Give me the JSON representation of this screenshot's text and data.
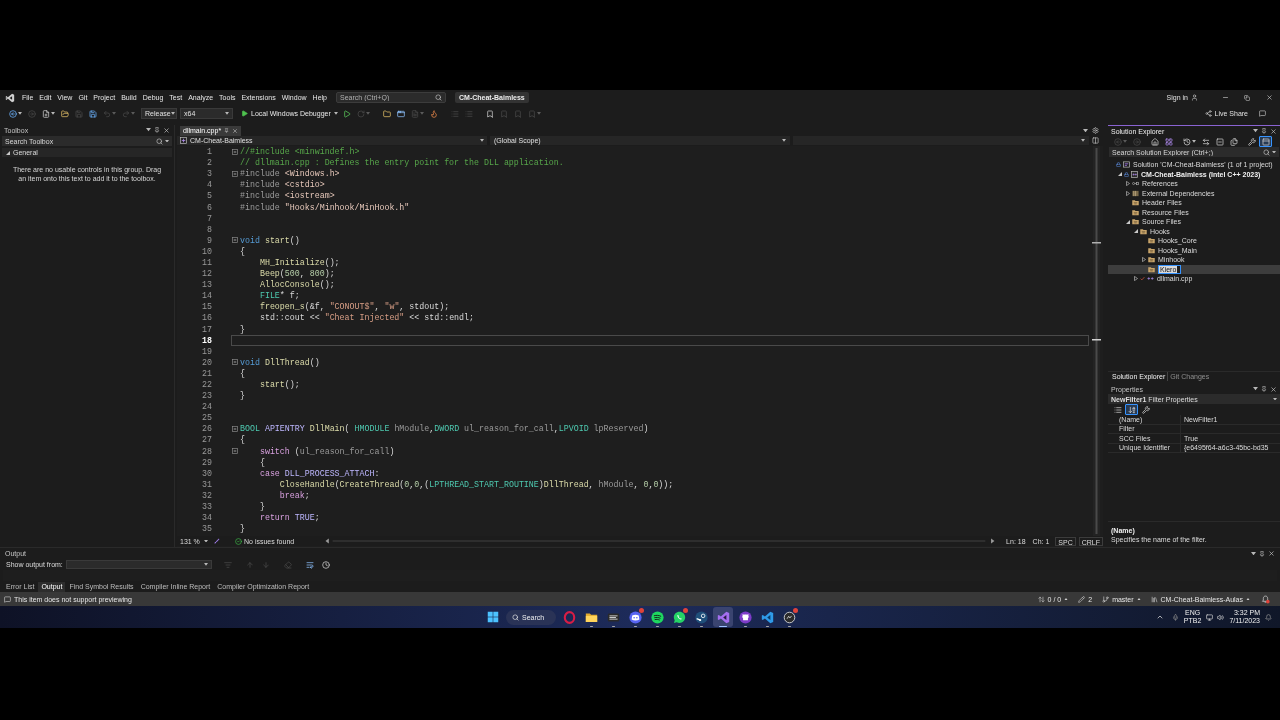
{
  "menu_bar": {
    "menus": [
      "File",
      "Edit",
      "View",
      "Git",
      "Project",
      "Build",
      "Debug",
      "Test",
      "Analyze",
      "Tools",
      "Extensions",
      "Window",
      "Help"
    ],
    "search": {
      "placeholder": "Search (Ctrl+Q)"
    },
    "solution": "CM-Cheat-Baimless",
    "sign_in": "Sign in"
  },
  "toolbar": {
    "left_buttons": [
      {
        "kind": "back",
        "disabled": false
      },
      {
        "kind": "forward",
        "disabled": true
      },
      {
        "kind": "new",
        "disabled": false
      },
      {
        "kind": "open",
        "disabled": false
      },
      {
        "kind": "save",
        "disabled": true
      },
      {
        "kind": "save_all",
        "disabled": false
      },
      {
        "kind": "undo",
        "disabled": true
      },
      {
        "kind": "redo",
        "disabled": true
      }
    ],
    "configuration": "Release",
    "platform": "x64",
    "debugger": "Local Windows Debugger",
    "right_buttons": [
      {
        "kind": "start",
        "disabled": false
      },
      {
        "kind": "restart",
        "disabled": true
      },
      {
        "kind": "browse",
        "disabled": false
      },
      {
        "kind": "window",
        "disabled": false
      },
      {
        "kind": "document",
        "disabled": true
      },
      {
        "kind": "hot_reload",
        "disabled": false
      },
      {
        "kind": "indent",
        "disabled": true
      },
      {
        "kind": "outdent",
        "disabled": true
      },
      {
        "kind": "bookmark",
        "disabled": false
      },
      {
        "kind": "previous_bookmark",
        "disabled": true
      },
      {
        "kind": "next_bookmark",
        "disabled": true
      },
      {
        "kind": "clear_bookmarks",
        "disabled": true
      }
    ],
    "live_share": "Live Share"
  },
  "toolbox": {
    "title": "Toolbox",
    "search": {
      "placeholder": "Search Toolbox"
    },
    "groups": [
      {
        "label": "General",
        "expanded": true
      }
    ],
    "message": "There are no usable controls in this group. Drag an item onto this text to add it to the toolbox."
  },
  "editor": {
    "tabs": [
      {
        "label": "dllmain.cpp*",
        "selected": true
      }
    ],
    "navigation": {
      "project": "CM-Cheat-Baimless",
      "scope": "(Global Scope)"
    },
    "lines": [
      {
        "number": "1",
        "fold": true,
        "current": false,
        "tokens": [
          {
            "text": "//#include <minwindef.h>",
            "kind": "comment"
          }
        ]
      },
      {
        "number": "2",
        "fold": false,
        "current": false,
        "tokens": [
          {
            "text": "// dllmain.cpp : Defines the entry point for the DLL application.",
            "kind": "comment"
          }
        ]
      },
      {
        "number": "3",
        "fold": true,
        "current": false,
        "tokens": [
          {
            "text": "#include",
            "kind": "directive"
          },
          {
            "text": " <Windows.h>",
            "kind": "header"
          }
        ]
      },
      {
        "number": "4",
        "fold": false,
        "current": false,
        "tokens": [
          {
            "text": "#include",
            "kind": "directive"
          },
          {
            "text": " <cstdio>",
            "kind": "header"
          }
        ]
      },
      {
        "number": "5",
        "fold": false,
        "current": false,
        "tokens": [
          {
            "text": "#include",
            "kind": "directive"
          },
          {
            "text": " <iostream>",
            "kind": "header"
          }
        ]
      },
      {
        "number": "6",
        "fold": false,
        "current": false,
        "tokens": [
          {
            "text": "#include",
            "kind": "directive"
          },
          {
            "text": " \"Hooks/Minhook/MinHook.h\"",
            "kind": "header"
          }
        ]
      },
      {
        "number": "7",
        "fold": false,
        "current": false
      },
      {
        "number": "8",
        "fold": false,
        "current": false
      },
      {
        "number": "9",
        "fold": true,
        "current": false,
        "tokens": [
          {
            "text": "void",
            "kind": "keyword"
          },
          {
            "text": " start",
            "kind": "function"
          },
          {
            "text": "()",
            "kind": "plain"
          }
        ]
      },
      {
        "number": "10",
        "fold": false,
        "current": false,
        "tokens": [
          {
            "text": "{",
            "kind": "plain"
          }
        ]
      },
      {
        "number": "11",
        "fold": false,
        "current": false,
        "tokens": [
          {
            "text": "    MH_Initialize",
            "kind": "function"
          },
          {
            "text": "();",
            "kind": "plain"
          }
        ]
      },
      {
        "number": "12",
        "fold": false,
        "current": false,
        "tokens": [
          {
            "text": "    Beep",
            "kind": "function"
          },
          {
            "text": "(",
            "kind": "plain"
          },
          {
            "text": "500",
            "kind": "number"
          },
          {
            "text": ", ",
            "kind": "plain"
          },
          {
            "text": "800",
            "kind": "number"
          },
          {
            "text": ");",
            "kind": "plain"
          }
        ]
      },
      {
        "number": "13",
        "fold": false,
        "current": false,
        "tokens": [
          {
            "text": "    AllocConsole",
            "kind": "function"
          },
          {
            "text": "();",
            "kind": "plain"
          }
        ]
      },
      {
        "number": "14",
        "fold": false,
        "current": false,
        "tokens": [
          {
            "text": "    FILE",
            "kind": "type"
          },
          {
            "text": "* f;",
            "kind": "plain"
          }
        ]
      },
      {
        "number": "15",
        "fold": false,
        "current": false,
        "tokens": [
          {
            "text": "    freopen_s",
            "kind": "function"
          },
          {
            "text": "(&f, ",
            "kind": "plain"
          },
          {
            "text": "\"CONOUT$\"",
            "kind": "string"
          },
          {
            "text": ", ",
            "kind": "plain"
          },
          {
            "text": "\"w\"",
            "kind": "string"
          },
          {
            "text": ", stdout);",
            "kind": "plain"
          }
        ]
      },
      {
        "number": "16",
        "fold": false,
        "current": false,
        "tokens": [
          {
            "text": "    std::cout << ",
            "kind": "plain"
          },
          {
            "text": "\"Cheat Injected\"",
            "kind": "string"
          },
          {
            "text": " << std::endl;",
            "kind": "plain"
          }
        ]
      },
      {
        "number": "17",
        "fold": false,
        "current": false,
        "tokens": [
          {
            "text": "}",
            "kind": "plain"
          }
        ]
      },
      {
        "number": "18",
        "fold": false,
        "current": true
      },
      {
        "number": "19",
        "fold": false,
        "current": false
      },
      {
        "number": "20",
        "fold": true,
        "current": false,
        "tokens": [
          {
            "text": "void",
            "kind": "keyword"
          },
          {
            "text": " DllThread",
            "kind": "function"
          },
          {
            "text": "()",
            "kind": "plain"
          }
        ]
      },
      {
        "number": "21",
        "fold": false,
        "current": false,
        "tokens": [
          {
            "text": "{",
            "kind": "plain"
          }
        ]
      },
      {
        "number": "22",
        "fold": false,
        "current": false,
        "tokens": [
          {
            "text": "    start",
            "kind": "function"
          },
          {
            "text": "();",
            "kind": "plain"
          }
        ]
      },
      {
        "number": "23",
        "fold": false,
        "current": false,
        "tokens": [
          {
            "text": "}",
            "kind": "plain"
          }
        ]
      },
      {
        "number": "24",
        "fold": false,
        "current": false
      },
      {
        "number": "25",
        "fold": false,
        "current": false
      },
      {
        "number": "26",
        "fold": true,
        "current": false,
        "tokens": [
          {
            "text": "BOOL",
            "kind": "type"
          },
          {
            "text": " APIENTRY",
            "kind": "macro"
          },
          {
            "text": " DllMain",
            "kind": "function"
          },
          {
            "text": "( ",
            "kind": "plain"
          },
          {
            "text": "HMODULE",
            "kind": "type"
          },
          {
            "text": " hModule",
            "kind": "param"
          },
          {
            "text": ",",
            "kind": "plain"
          },
          {
            "text": "DWORD",
            "kind": "type"
          },
          {
            "text": " ul_reason_for_call",
            "kind": "param"
          },
          {
            "text": ",",
            "kind": "plain"
          },
          {
            "text": "LPVOID",
            "kind": "type"
          },
          {
            "text": " lpReserved",
            "kind": "param"
          },
          {
            "text": ")",
            "kind": "plain"
          }
        ]
      },
      {
        "number": "27",
        "fold": false,
        "current": false,
        "tokens": [
          {
            "text": "{",
            "kind": "plain"
          }
        ]
      },
      {
        "number": "28",
        "fold": true,
        "current": false,
        "tokens": [
          {
            "text": "    switch",
            "kind": "control"
          },
          {
            "text": " (",
            "kind": "plain"
          },
          {
            "text": "ul_reason_for_call",
            "kind": "param"
          },
          {
            "text": ")",
            "kind": "plain"
          }
        ]
      },
      {
        "number": "29",
        "fold": false,
        "current": false,
        "tokens": [
          {
            "text": "    {",
            "kind": "plain"
          }
        ]
      },
      {
        "number": "30",
        "fold": false,
        "current": false,
        "tokens": [
          {
            "text": "    case",
            "kind": "control"
          },
          {
            "text": " DLL_PROCESS_ATTACH",
            "kind": "macro"
          },
          {
            "text": ":",
            "kind": "plain"
          }
        ]
      },
      {
        "number": "31",
        "fold": false,
        "current": false,
        "tokens": [
          {
            "text": "        CloseHandle",
            "kind": "function"
          },
          {
            "text": "(",
            "kind": "plain"
          },
          {
            "text": "CreateThread",
            "kind": "function"
          },
          {
            "text": "(",
            "kind": "plain"
          },
          {
            "text": "0",
            "kind": "number"
          },
          {
            "text": ",",
            "kind": "plain"
          },
          {
            "text": "0",
            "kind": "number"
          },
          {
            "text": ",(",
            "kind": "plain"
          },
          {
            "text": "LPTHREAD_START_ROUTINE",
            "kind": "type"
          },
          {
            "text": ")",
            "kind": "plain"
          },
          {
            "text": "DllThread",
            "kind": "function"
          },
          {
            "text": ", ",
            "kind": "plain"
          },
          {
            "text": "hModule",
            "kind": "param"
          },
          {
            "text": ", ",
            "kind": "plain"
          },
          {
            "text": "0",
            "kind": "number"
          },
          {
            "text": ",",
            "kind": "plain"
          },
          {
            "text": "0",
            "kind": "number"
          },
          {
            "text": "));",
            "kind": "plain"
          }
        ]
      },
      {
        "number": "32",
        "fold": false,
        "current": false,
        "tokens": [
          {
            "text": "        break",
            "kind": "control"
          },
          {
            "text": ";",
            "kind": "plain"
          }
        ]
      },
      {
        "number": "33",
        "fold": false,
        "current": false,
        "tokens": [
          {
            "text": "    }",
            "kind": "plain"
          }
        ]
      },
      {
        "number": "34",
        "fold": false,
        "current": false,
        "tokens": [
          {
            "text": "    return",
            "kind": "control"
          },
          {
            "text": " TRUE",
            "kind": "macro"
          },
          {
            "text": ";",
            "kind": "plain"
          }
        ]
      },
      {
        "number": "35",
        "fold": false,
        "current": false,
        "tokens": [
          {
            "text": "}",
            "kind": "plain"
          }
        ]
      }
    ],
    "status": {
      "zoom": "131 %",
      "issues": "No issues found",
      "line": "Ln: 18",
      "column": "Ch: 1",
      "whitespace": "SPC",
      "line_endings": "CRLF"
    }
  },
  "solution_explorer": {
    "title": "Solution Explorer",
    "toolbar": [
      {
        "kind": "back",
        "disabled": true,
        "pressed": false
      },
      {
        "kind": "forward",
        "disabled": true,
        "pressed": false
      },
      {
        "kind": "home",
        "disabled": false,
        "pressed": false
      },
      {
        "kind": "switch_views",
        "disabled": false,
        "pressed": false
      },
      {
        "kind": "pending_changes",
        "disabled": false,
        "pressed": false
      },
      {
        "kind": "sync",
        "disabled": false,
        "pressed": false
      },
      {
        "kind": "collapse_all",
        "disabled": false,
        "pressed": false
      },
      {
        "kind": "show_all_files",
        "disabled": false,
        "pressed": false
      },
      {
        "kind": "properties",
        "disabled": false,
        "pressed": false
      },
      {
        "kind": "preview",
        "disabled": false,
        "pressed": true
      }
    ],
    "search": {
      "placeholder": "Search Solution Explorer (Ctrl+;)"
    },
    "tree": [
      {
        "label": "Solution 'CM-Cheat-Baimless' (1 of 1 project)",
        "kind": "solution",
        "selected": false,
        "editing": false,
        "children": [
          {
            "label": "CM-Cheat-Baimless (Intel C++ 2023)",
            "kind": "project",
            "expanded": true,
            "selected": false,
            "editing": false,
            "children": [
              {
                "label": "References",
                "kind": "references",
                "expanded": false,
                "selected": false,
                "editing": false
              },
              {
                "label": "External Dependencies",
                "kind": "dependencies",
                "expanded": false,
                "selected": false,
                "editing": false
              },
              {
                "label": "Header Files",
                "kind": "filter",
                "selected": false,
                "editing": false
              },
              {
                "label": "Resource Files",
                "kind": "filter",
                "selected": false,
                "editing": false
              },
              {
                "label": "Source Files",
                "kind": "filter",
                "expanded": true,
                "selected": false,
                "editing": false,
                "children": [
                  {
                    "label": "Hooks",
                    "kind": "filter",
                    "expanded": true,
                    "selected": false,
                    "editing": false,
                    "children": [
                      {
                        "label": "Hooks_Core",
                        "kind": "filter",
                        "selected": false,
                        "editing": false
                      },
                      {
                        "label": "Hooks_Main",
                        "kind": "filter",
                        "selected": false,
                        "editing": false
                      },
                      {
                        "label": "Minhook",
                        "kind": "filter",
                        "expanded": false,
                        "selected": false,
                        "editing": false
                      },
                      {
                        "label": "Kiero",
                        "kind": "filter",
                        "selected": true,
                        "editing": true
                      }
                    ]
                  },
                  {
                    "label": "dllmain.cpp",
                    "kind": "file",
                    "expanded": false,
                    "selected": false,
                    "editing": false
                  }
                ]
              }
            ]
          }
        ]
      }
    ],
    "tabs": [
      {
        "label": "Solution Explorer",
        "selected": true
      },
      {
        "label": "Git Changes",
        "selected": false
      }
    ]
  },
  "properties": {
    "title": "Properties",
    "object": "**NewFilter1** Filter Properties",
    "toolbar": [
      {
        "kind": "categorized",
        "pressed": false
      },
      {
        "kind": "alphabetical",
        "pressed": true
      },
      {
        "kind": "property_pages",
        "pressed": false
      }
    ],
    "rows": [
      {
        "name": "(Name)",
        "value": "NewFilter1"
      },
      {
        "name": "Filter"
      },
      {
        "name": "SCC Files",
        "value": "True"
      },
      {
        "name": "Unique Identifier",
        "value": "{e6495f64-a6c3-45bc-bd35"
      }
    ],
    "description": {
      "title": "(Name)",
      "text": "Specifies the name of the filter."
    }
  },
  "output": {
    "title": "Output",
    "source_label": "Show output from:",
    "toolbar": [
      {
        "kind": "find_message",
        "disabled": true
      },
      {
        "kind": "previous_message",
        "disabled": true
      },
      {
        "kind": "next_message",
        "disabled": true
      },
      {
        "kind": "clear_all",
        "disabled": true
      },
      {
        "kind": "word_wrap",
        "disabled": false
      },
      {
        "kind": "timestamps",
        "disabled": false
      }
    ],
    "tabs": [
      {
        "label": "Error List",
        "selected": false
      },
      {
        "label": "Output",
        "selected": true
      },
      {
        "label": "Find Symbol Results",
        "selected": false
      },
      {
        "label": "Compiler Inline Report",
        "selected": false
      },
      {
        "label": "Compiler Optimization Report",
        "selected": false
      }
    ]
  },
  "status_bar": {
    "message": "This item does not support previewing",
    "items": [
      {
        "kind": "sync",
        "text": "0 / 0"
      },
      {
        "kind": "changes",
        "text": "2"
      },
      {
        "kind": "branch",
        "text": "master"
      },
      {
        "kind": "repository",
        "text": "CM-Cheat-Baimless-Aulas"
      }
    ]
  },
  "taskbar": {
    "search": "Search",
    "apps": [
      {
        "kind": "browser",
        "running": false,
        "active": false,
        "badge": false
      },
      {
        "kind": "file_explorer",
        "running": true,
        "active": false,
        "badge": false
      },
      {
        "kind": "utility",
        "running": true,
        "active": false,
        "badge": false
      },
      {
        "kind": "voice_chat",
        "running": true,
        "active": false,
        "badge": true
      },
      {
        "kind": "music",
        "running": true,
        "active": false,
        "badge": false
      },
      {
        "kind": "messenger",
        "running": true,
        "active": false,
        "badge": true
      },
      {
        "kind": "game_store",
        "running": true,
        "active": false,
        "badge": false
      },
      {
        "kind": "ide",
        "running": true,
        "active": true,
        "badge": false
      },
      {
        "kind": "git_client",
        "running": true,
        "active": false,
        "badge": false
      },
      {
        "kind": "code_editor",
        "running": true,
        "active": false,
        "badge": false
      },
      {
        "kind": "capture",
        "running": true,
        "active": false,
        "badge": true
      }
    ],
    "language": "ENG",
    "keyboard": "PTB2",
    "time": "3:32 PM",
    "date": "7/11/2023"
  }
}
